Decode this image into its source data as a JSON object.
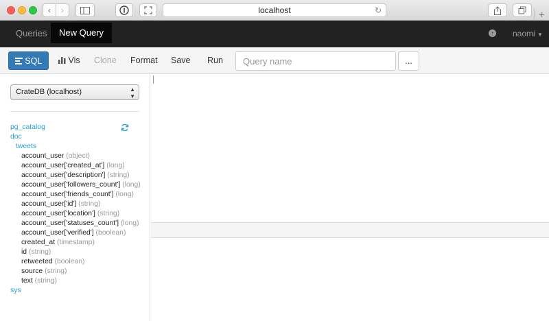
{
  "browser": {
    "url": "localhost"
  },
  "nav": {
    "queries": "Queries",
    "new_query": "New Query",
    "user": "naomi"
  },
  "toolbar": {
    "sql": "SQL",
    "vis": "Vis",
    "clone": "Clone",
    "format": "Format",
    "save": "Save",
    "run": "Run",
    "query_name_placeholder": "Query name",
    "more": "..."
  },
  "sidebar": {
    "datasource": "CrateDB (localhost)",
    "schemas": {
      "pg_catalog": "pg_catalog",
      "doc": "doc",
      "tweets": "tweets",
      "sys": "sys"
    },
    "columns": [
      {
        "name": "account_user",
        "type": "(object)"
      },
      {
        "name": "account_user['created_at']",
        "type": "(long)"
      },
      {
        "name": "account_user['description']",
        "type": "(string)"
      },
      {
        "name": "account_user['followers_count']",
        "type": "(long)"
      },
      {
        "name": "account_user['friends_count']",
        "type": "(long)"
      },
      {
        "name": "account_user['id']",
        "type": "(string)"
      },
      {
        "name": "account_user['location']",
        "type": "(string)"
      },
      {
        "name": "account_user['statuses_count']",
        "type": "(long)"
      },
      {
        "name": "account_user['verified']",
        "type": "(boolean)"
      },
      {
        "name": "created_at",
        "type": "(timestamp)"
      },
      {
        "name": "id",
        "type": "(string)"
      },
      {
        "name": "retweeted",
        "type": "(boolean)"
      },
      {
        "name": "source",
        "type": "(string)"
      },
      {
        "name": "text",
        "type": "(string)"
      }
    ]
  }
}
